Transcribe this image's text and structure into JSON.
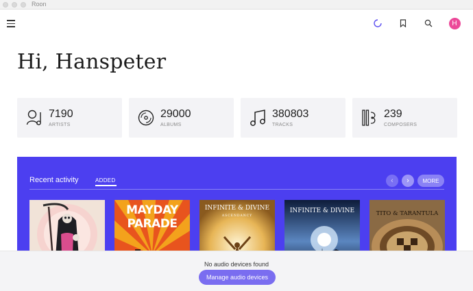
{
  "window": {
    "title": "Roon"
  },
  "header": {
    "menu_icon": "hamburger-icon",
    "icons": [
      "loading-spinner-icon",
      "bookmark-icon",
      "search-icon"
    ],
    "avatar_initial": "H",
    "avatar_color": "#ec4899"
  },
  "greeting": "Hi, Hanspeter",
  "stats": [
    {
      "value": "7190",
      "label": "ARTISTS",
      "icon": "artist-icon"
    },
    {
      "value": "29000",
      "label": "ALBUMS",
      "icon": "album-disc-icon"
    },
    {
      "value": "380803",
      "label": "TRACKS",
      "icon": "music-note-icon"
    },
    {
      "value": "239",
      "label": "COMPOSERS",
      "icon": "composer-icon"
    }
  ],
  "recent_activity": {
    "title": "Recent activity",
    "tab": "ADDED",
    "more_label": "MORE",
    "accent_color": "#4c3ff0",
    "albums": [
      {
        "cover_text": "",
        "theme": "reaper-pink"
      },
      {
        "cover_text": "MAYDAY PARADE",
        "theme": "orange-sunburst"
      },
      {
        "cover_text": "INFINITE & DIVINE",
        "subtitle": "ASCENDANCY",
        "theme": "golden-figure"
      },
      {
        "cover_text": "INFINITE & DIVINE",
        "theme": "blue-sky"
      },
      {
        "cover_text": "TITO & TARANTULA",
        "theme": "sepia-snake"
      }
    ]
  },
  "footer": {
    "message": "No audio devices found",
    "button_label": "Manage audio devices",
    "button_color": "#7a6df0"
  }
}
